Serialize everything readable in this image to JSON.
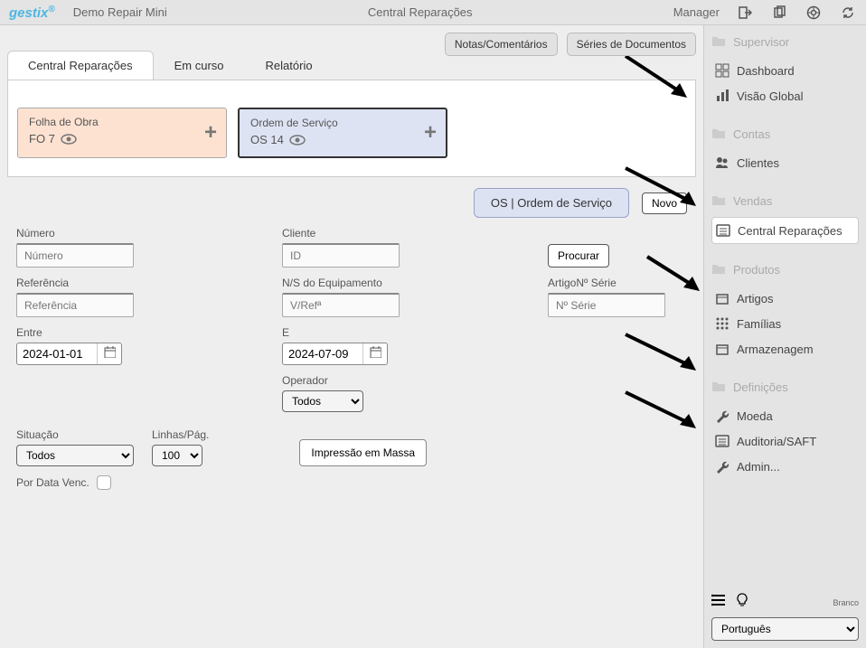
{
  "header": {
    "logo": "gestix",
    "demo": "Demo Repair Mini",
    "center": "Central Reparações",
    "user": "Manager"
  },
  "topButtons": {
    "notes": "Notas/Comentários",
    "series": "Séries de Documentos"
  },
  "tabs": {
    "t1": "Central Reparações",
    "t2": "Em curso",
    "t3": "Relatório"
  },
  "cards": {
    "fo_title": "Folha de Obra",
    "fo_sub": "FO 7",
    "os_title": "Ordem de Serviço",
    "os_sub": "OS 14"
  },
  "pill": "OS | Ordem de Serviço",
  "novo": "Novo",
  "form": {
    "numero_label": "Número",
    "numero_ph": "Número",
    "cliente_label": "Cliente",
    "cliente_ph": "ID",
    "procurar": "Procurar",
    "ref_label": "Referência",
    "ref_ph": "Referência",
    "ns_label": "N/S do Equipamento",
    "ns_ph": "V/Refª",
    "artigo_label": "ArtigoNº Série",
    "artigo_ph": "Nº Série",
    "entre_label": "Entre",
    "entre_val": "2024-01-01",
    "e_label": "E",
    "e_val": "2024-07-09",
    "operador_label": "Operador",
    "operador_val": "Todos",
    "situacao_label": "Situação",
    "situacao_val": "Todos",
    "linhas_label": "Linhas/Pág.",
    "linhas_val": "100",
    "mass": "Impressão em Massa",
    "por_data": "Por Data Venc."
  },
  "sidebar": {
    "g1": "Supervisor",
    "g1_i1": "Dashboard",
    "g1_i2": "Visão Global",
    "g2": "Contas",
    "g2_i1": "Clientes",
    "g3": "Vendas",
    "g3_i1": "Central Reparações",
    "g4": "Produtos",
    "g4_i1": "Artigos",
    "g4_i2": "Famílias",
    "g4_i3": "Armazenagem",
    "g5": "Definições",
    "g5_i1": "Moeda",
    "g5_i2": "Auditoria/SAFT",
    "g5_i3": "Admin..."
  },
  "footer": {
    "branco": "Branco",
    "lang": "Português"
  }
}
